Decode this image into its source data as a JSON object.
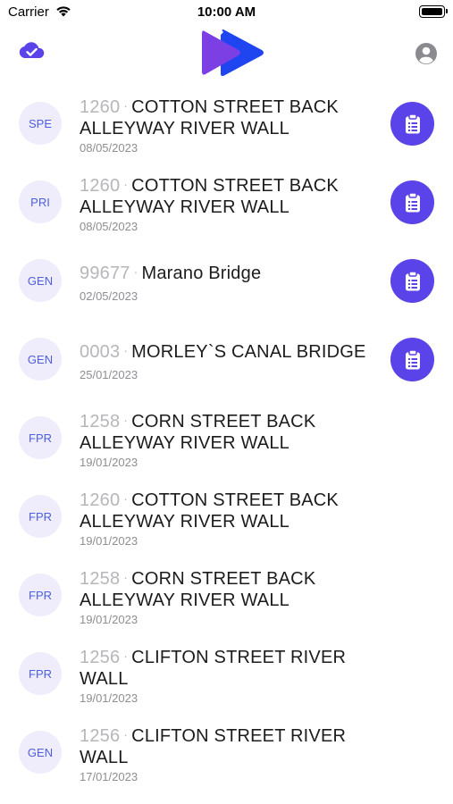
{
  "status_bar": {
    "carrier": "Carrier",
    "time": "10:00 AM"
  },
  "nav": {
    "sync_icon": "cloud-check-icon",
    "logo_icon": "double-play-logo-icon",
    "profile_icon": "person-circle-icon"
  },
  "colors": {
    "accent": "#5a43e8",
    "avatar_bg": "#efedfb",
    "avatar_text": "#4d5fe0",
    "logo_purple": "#7b3fe4",
    "logo_blue": "#1f45f0"
  },
  "items": [
    {
      "type": "SPE",
      "code": "1260",
      "name": "COTTON STREET BACK ALLEYWAY RIVER WALL",
      "date": "08/05/2023",
      "has_action": true
    },
    {
      "type": "PRI",
      "code": "1260",
      "name": "COTTON STREET BACK ALLEYWAY RIVER WALL",
      "date": "08/05/2023",
      "has_action": true
    },
    {
      "type": "GEN",
      "code": "99677",
      "name": "Marano Bridge",
      "date": "02/05/2023",
      "has_action": true
    },
    {
      "type": "GEN",
      "code": "0003",
      "name": "MORLEY`S CANAL BRIDGE",
      "date": "25/01/2023",
      "has_action": true
    },
    {
      "type": "FPR",
      "code": "1258",
      "name": "CORN STREET BACK ALLEYWAY RIVER WALL",
      "date": "19/01/2023",
      "has_action": false
    },
    {
      "type": "FPR",
      "code": "1260",
      "name": "COTTON STREET BACK ALLEYWAY RIVER WALL",
      "date": "19/01/2023",
      "has_action": false
    },
    {
      "type": "FPR",
      "code": "1258",
      "name": "CORN STREET BACK ALLEYWAY RIVER WALL",
      "date": "19/01/2023",
      "has_action": false
    },
    {
      "type": "FPR",
      "code": "1256",
      "name": "CLIFTON STREET RIVER WALL",
      "date": "19/01/2023",
      "has_action": false
    },
    {
      "type": "GEN",
      "code": "1256",
      "name": "CLIFTON STREET RIVER WALL",
      "date": "17/01/2023",
      "has_action": false
    }
  ],
  "separator": "·",
  "action_icon": "clipboard-list-icon"
}
